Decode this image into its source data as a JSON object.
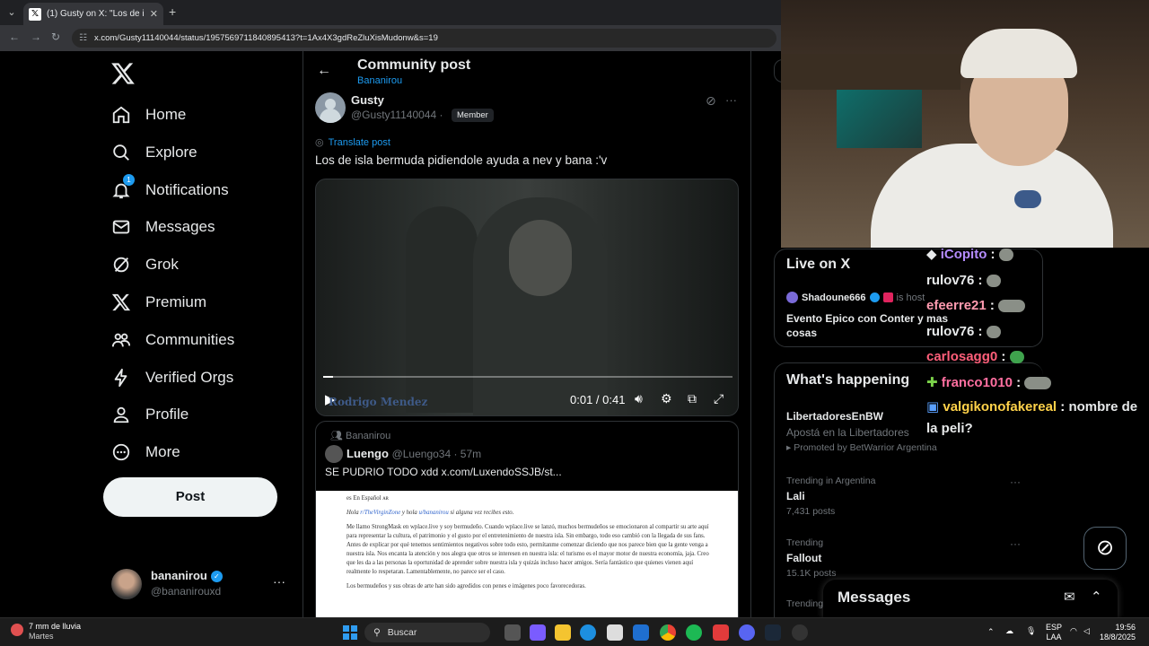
{
  "browser": {
    "tab_title": "(1) Gusty on X: \"Los de isla bermuda pidiendole ayuda a nev y bana :'v\"",
    "url": "x.com/Gusty11140044/status/1957569711840895413?t=1Ax4X3gdReZluXisMudonw&s=19"
  },
  "sidebar": {
    "items": [
      {
        "label": "Home",
        "icon": "home-icon"
      },
      {
        "label": "Explore",
        "icon": "search-icon"
      },
      {
        "label": "Notifications",
        "icon": "bell-icon",
        "badge": "1"
      },
      {
        "label": "Messages",
        "icon": "envelope-icon"
      },
      {
        "label": "Grok",
        "icon": "grok-icon"
      },
      {
        "label": "Premium",
        "icon": "x-logo-icon"
      },
      {
        "label": "Communities",
        "icon": "people-icon"
      },
      {
        "label": "Verified Orgs",
        "icon": "lightning-icon"
      },
      {
        "label": "Profile",
        "icon": "person-icon"
      },
      {
        "label": "More",
        "icon": "more-circle-icon"
      }
    ],
    "post_button": "Post",
    "account": {
      "name": "bananirou",
      "handle": "@bananirouxd"
    }
  },
  "header": {
    "title": "Community post",
    "community": "Bananirou"
  },
  "post": {
    "author": "Gusty",
    "handle": "@Gusty11140044",
    "separator": "·",
    "role": "Member",
    "translate": "Translate post",
    "text": "Los de isla bermuda pidiendole ayuda a nev y bana :'v",
    "video": {
      "watermark": "Rodrigo Mendez",
      "time": "0:01 / 0:41",
      "progress": 0.024
    }
  },
  "quote": {
    "community": "Bananirou",
    "author": "Luengo",
    "handle": "@Luengo34 · 57m",
    "text": "SE PUDRIO TODO xdd  x.com/LuxendoSSJB/st...",
    "doc": {
      "heading": "es En Español ᴀʀ",
      "greeting_pre": "Hola ",
      "greeting_link1": "r/TheVirginZone",
      "greeting_mid": " y hola ",
      "greeting_link2": "u/bananirou",
      "greeting_post": " si alguna vez recibes esto.",
      "para1": "Me llamo StrongMask en wplace.live y soy bermudeño. Cuando wplace.live se lanzó, muchos bermudeños se emocionaron al compartir su arte aquí para representar la cultura, el patrimonio y el gusto por el entretenimiento de nuestra isla. Sin embargo, todo eso cambió con la llegada de sus fans. Antes de explicar por qué tenemos sentimientos negativos sobre todo esto, permítanme comenzar diciendo que nos parece bien que la gente venga a nuestra isla. Nos encanta la atención y nos alegra que otros se interesen en nuestra isla: el turismo es el mayor motor de nuestra economía, jaja. Creo que les da a las personas la oportunidad de aprender sobre nuestra isla y quizás incluso hacer amigos. Sería fantástico que quienes vienen aquí realmente lo respetaran. Lamentablemente, no parece ser el caso.",
      "para2": "Los bermudeños y sus obras de arte han sido agredidos con penes e imágenes poco favorecedoras."
    }
  },
  "live": {
    "title": "Live on X",
    "host": "Shadoune666",
    "host_suffix": "is host",
    "event": "Evento Epico con Conter y mas cosas"
  },
  "happening": {
    "title": "What's happening",
    "trends": [
      {
        "context": "",
        "name": "LibertadoresEnBW",
        "line": "Apostá en la Libertadores",
        "promo": "Promoted by BetWarrior Argentina"
      },
      {
        "context": "Trending in Argentina",
        "name": "Lali",
        "count": "7,431 posts"
      },
      {
        "context": "Trending",
        "name": "Fallout",
        "count": "15.1K posts"
      },
      {
        "context": "Trending",
        "name": "",
        "count": ""
      }
    ]
  },
  "chat": [
    {
      "user": "iCopito",
      "color": "#b58cff",
      "msg": ""
    },
    {
      "user": "rulov76",
      "color": "#ffffff",
      "msg": ""
    },
    {
      "user": "efeerre21",
      "color": "#ff9bb0",
      "msg": ""
    },
    {
      "user": "rulov76",
      "color": "#ffffff",
      "msg": ""
    },
    {
      "user": "carlosagg0",
      "color": "#ff5f7a",
      "msg": ""
    },
    {
      "user": "franco1010",
      "color": "#ff6fa0",
      "msg": ""
    },
    {
      "user": "valgikonofakereal",
      "color": "#ffd24a",
      "msg": "nombre de la peli?"
    }
  ],
  "messages_drawer": {
    "title": "Messages"
  },
  "taskbar": {
    "weather_line1": "7 mm de lluvia",
    "weather_line2": "Martes",
    "search": "Buscar",
    "lang1": "ESP",
    "lang2": "LAA",
    "time": "19:56",
    "date": "18/8/2025"
  },
  "colors": {
    "accent": "#1d9bf0",
    "bg": "#000000",
    "text": "#e7e9ea",
    "muted": "#71767b"
  }
}
